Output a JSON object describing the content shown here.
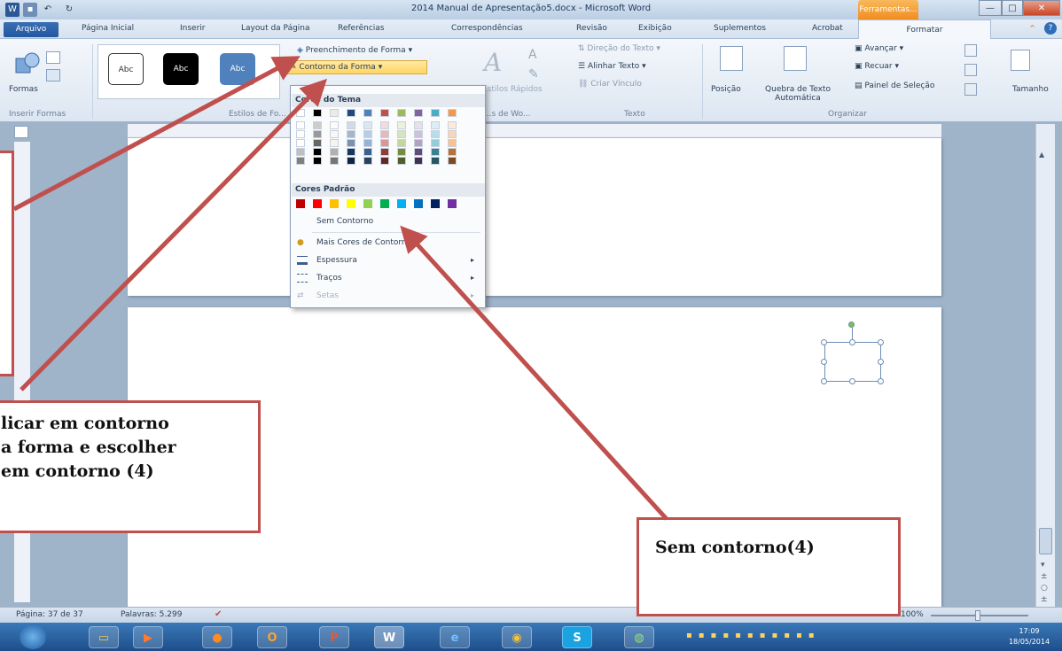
{
  "window": {
    "title": "2014 Manual de Apresentação5.docx - Microsoft Word",
    "contextual_tab_group": "Ferramentas...",
    "controls": [
      "—",
      "□",
      "✕"
    ]
  },
  "tabs": [
    "Arquivo",
    "Página Inicial",
    "Inserir",
    "Layout da Página",
    "Referências",
    "Correspondências",
    "Revisão",
    "Exibição",
    "Suplementos",
    "Acrobat",
    "Formatar"
  ],
  "ribbon": {
    "insert_shapes": {
      "button": "Formas",
      "label": "Inserir Formas"
    },
    "shape_styles": {
      "label": "Estilos de Fo...",
      "styles": [
        "Abc",
        "Abc",
        "Abc"
      ],
      "shape_fill": "Preenchimento de Forma",
      "shape_outline": "Contorno da Forma"
    },
    "wordart": {
      "label": "...s de Wo...",
      "quick_styles": "Estilos Rápidos"
    },
    "text": {
      "label": "Texto",
      "direction": "Direção do Texto",
      "align": "Alinhar Texto",
      "link": "Criar Vínculo"
    },
    "arrange": {
      "label": "Organizar",
      "position": "Posição",
      "wrap": "Quebra de Texto Automática",
      "bring_forward": "Avançar",
      "send_backward": "Recuar",
      "selection_pane": "Painel de Seleção"
    },
    "size": {
      "button": "Tamanho"
    }
  },
  "dropdown": {
    "theme_colors_header": "Cores do Tema",
    "standard_colors_header": "Cores Padrão",
    "theme_colors": [
      "#ffffff",
      "#000000",
      "#eeece1",
      "#1f497d",
      "#4f81bd",
      "#c0504d",
      "#9bbb59",
      "#8064a2",
      "#4bacc6",
      "#f79646"
    ],
    "standard_colors": [
      "#c00000",
      "#ff0000",
      "#ffc000",
      "#ffff00",
      "#92d050",
      "#00b050",
      "#00b0f0",
      "#0070c0",
      "#002060",
      "#7030a0"
    ],
    "items": {
      "no_outline": "Sem Contorno",
      "more_colors": "Mais Cores de Contorno...",
      "weight": "Espessura",
      "dashes": "Traços",
      "arrows": "Setas"
    }
  },
  "status_bar": {
    "page": "Página: 37 de 37",
    "words": "Palavras: 5.299",
    "zoom": "100%"
  },
  "taskbar": {
    "time": "17:09",
    "date": "18/05/2014"
  },
  "callouts": {
    "left_line1": "licar em contorno",
    "left_line2": "a forma e escolher",
    "left_line3": "em contorno (4)",
    "right": "Sem contorno(4)"
  }
}
